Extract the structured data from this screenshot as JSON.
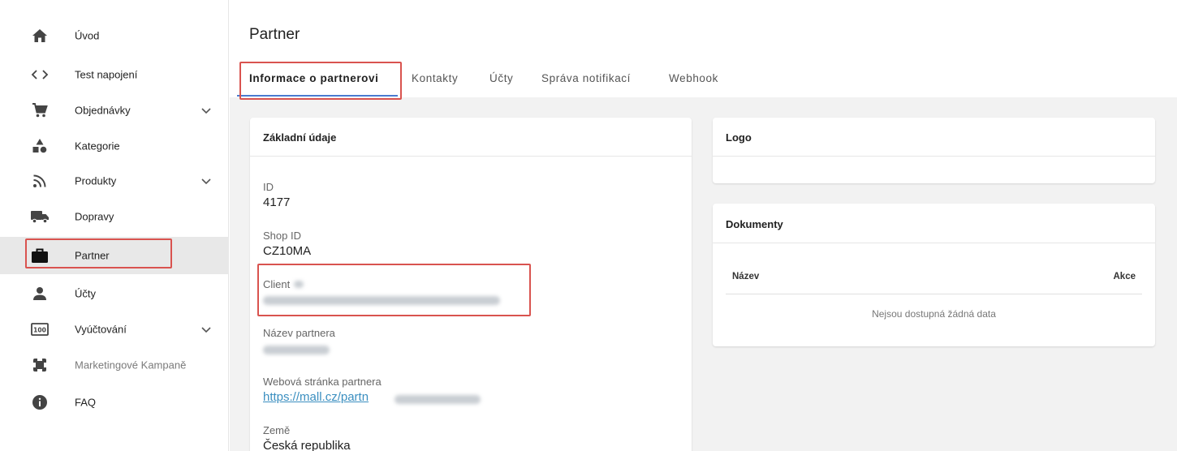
{
  "sidebar": {
    "items": [
      {
        "label": "Úvod",
        "icon": "home-icon"
      },
      {
        "label": "Test napojení",
        "icon": "code-icon"
      },
      {
        "label": "Objednávky",
        "icon": "cart-icon",
        "expandable": true
      },
      {
        "label": "Kategorie",
        "icon": "category-icon"
      },
      {
        "label": "Produkty",
        "icon": "rss-icon",
        "expandable": true
      },
      {
        "label": "Dopravy",
        "icon": "truck-icon"
      },
      {
        "label": "Partner",
        "icon": "briefcase-icon",
        "active": true
      },
      {
        "label": "Účty",
        "icon": "person-icon"
      },
      {
        "label": "Vyúčtování",
        "icon": "billing-icon",
        "expandable": true
      },
      {
        "label": "Marketingové Kampaně",
        "icon": "campaign-icon",
        "muted": true
      },
      {
        "label": "FAQ",
        "icon": "info-icon"
      }
    ]
  },
  "header": {
    "title": "Partner",
    "tabs": [
      {
        "label": "Informace o partnerovi",
        "active": true
      },
      {
        "label": "Kontakty"
      },
      {
        "label": "Účty"
      },
      {
        "label": "Správa notifikací"
      },
      {
        "label": "Webhook"
      }
    ]
  },
  "basic": {
    "title": "Základní údaje",
    "id_label": "ID",
    "id_value": "4177",
    "shop_label": "Shop ID",
    "shop_value": "CZ10MA",
    "client_label": "Client",
    "name_label": "Název partnera",
    "web_label": "Webová stránka partnera",
    "web_value": "https://mall.cz/partn",
    "country_label": "Země",
    "country_value": "Česká republika"
  },
  "logo": {
    "title": "Logo"
  },
  "documents": {
    "title": "Dokumenty",
    "col_name": "Název",
    "col_actions": "Akce",
    "empty": "Nejsou dostupná žádná data"
  },
  "colors": {
    "highlight": "#d9534f",
    "tab_indicator": "#4a7bd0",
    "link": "#3b8fc0"
  }
}
